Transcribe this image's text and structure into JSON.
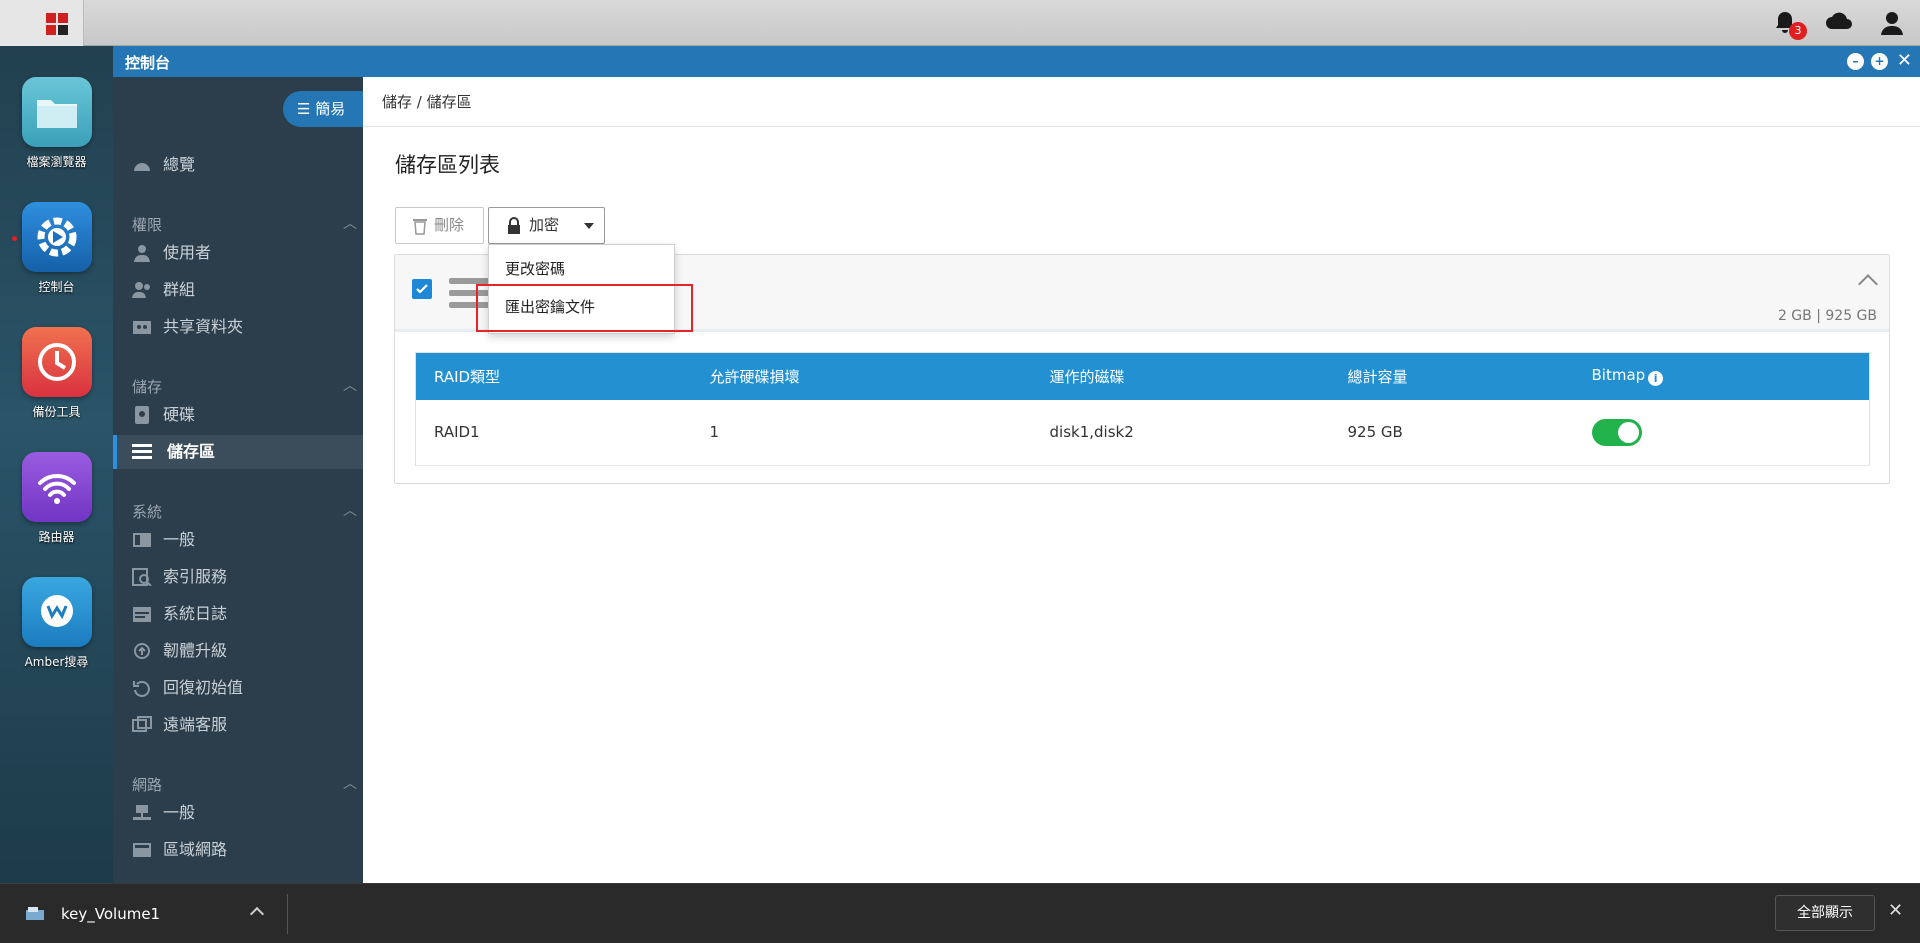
{
  "taskbar": {
    "notification_count": "3"
  },
  "desktop_apps": [
    {
      "label": "檔案瀏覽器"
    },
    {
      "label": "控制台"
    },
    {
      "label": "備份工具"
    },
    {
      "label": "路由器"
    },
    {
      "label": "Amber搜尋"
    }
  ],
  "window": {
    "title": "控制台"
  },
  "sidenav": {
    "mode_label": "簡易",
    "overview": "總覽",
    "sections": [
      {
        "title": "權限",
        "items": [
          "使用者",
          "群組",
          "共享資料夾"
        ]
      },
      {
        "title": "儲存",
        "items": [
          "硬碟",
          "儲存區"
        ]
      },
      {
        "title": "系統",
        "items": [
          "一般",
          "索引服務",
          "系統日誌",
          "韌體升級",
          "回復初始值",
          "遠端客服"
        ]
      },
      {
        "title": "網路",
        "items": [
          "一般",
          "區域網路"
        ]
      }
    ],
    "active_item": "儲存區"
  },
  "main": {
    "breadcrumb": "儲存 / 儲存區",
    "page_title": "儲存區列表",
    "toolbar": {
      "delete_label": "刪除",
      "encrypt_label": "加密"
    },
    "dropdown": {
      "items": [
        "更改密碼",
        "匯出密鑰文件"
      ]
    },
    "volume": {
      "checked": true,
      "usage_used": "2 GB",
      "usage_total": "925 GB",
      "table": {
        "headers": [
          "RAID類型",
          "允許硬碟損壞",
          "運作的磁碟",
          "總計容量",
          "Bitmap"
        ],
        "rows": [
          [
            "RAID1",
            "1",
            "disk1,disk2",
            "925 GB"
          ]
        ],
        "bitmap_enabled": true
      }
    }
  },
  "bottombar": {
    "download_name": "key_Volume1",
    "show_all_label": "全部顯示"
  },
  "colors": {
    "accent": "#2476b5",
    "table_header": "#2391d1",
    "toggle_on": "#21b24b",
    "highlight": "#e5252c"
  }
}
